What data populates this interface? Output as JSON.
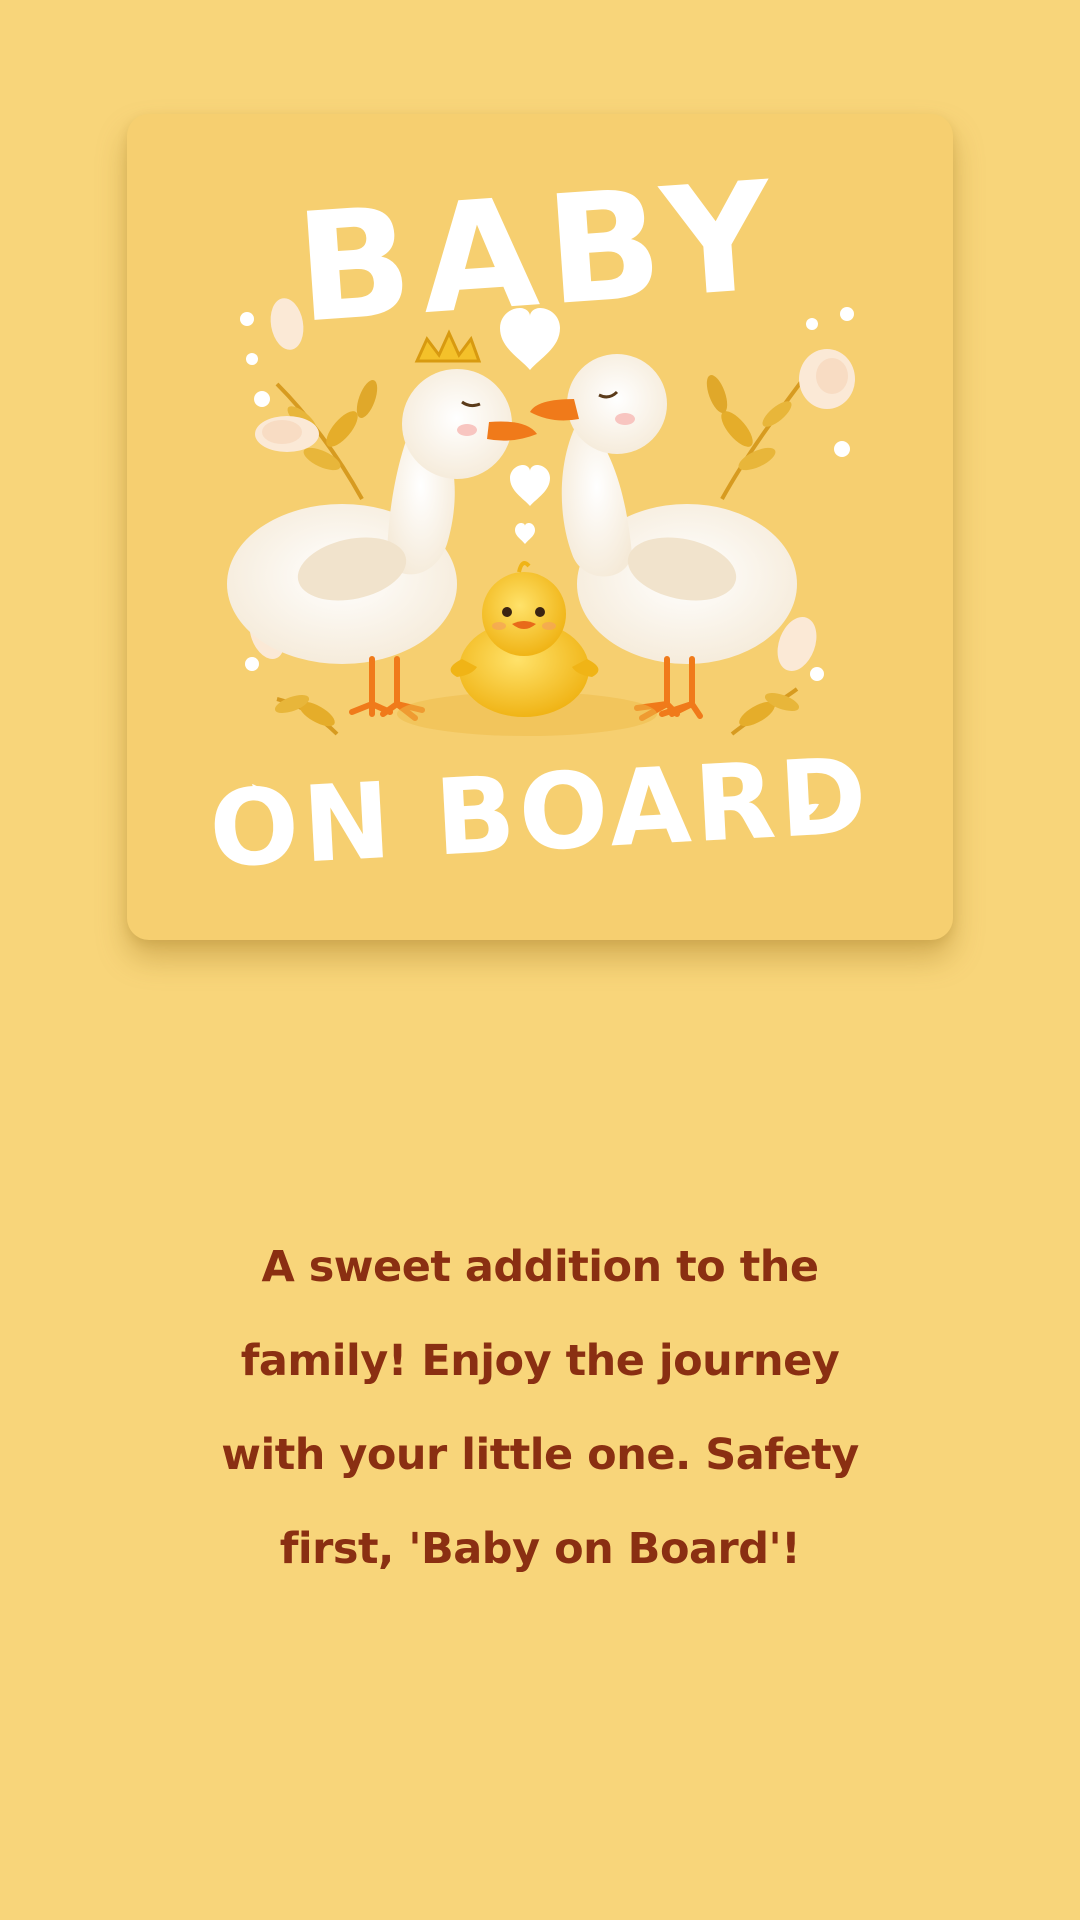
{
  "sticker": {
    "title_top": "BABY",
    "title_bottom": "ON BOARD"
  },
  "message": {
    "text": "A sweet addition to the family! Enjoy the journey with your little one. Safety first, 'Baby on Board'!"
  },
  "colors": {
    "background": "#f8d57a",
    "card": "#f6cf70",
    "text": "#8a2f12",
    "duck_white": "#ffffff",
    "beak": "#f07a1a",
    "duckling": "#f7c52a",
    "foliage": "#e0a82a"
  }
}
